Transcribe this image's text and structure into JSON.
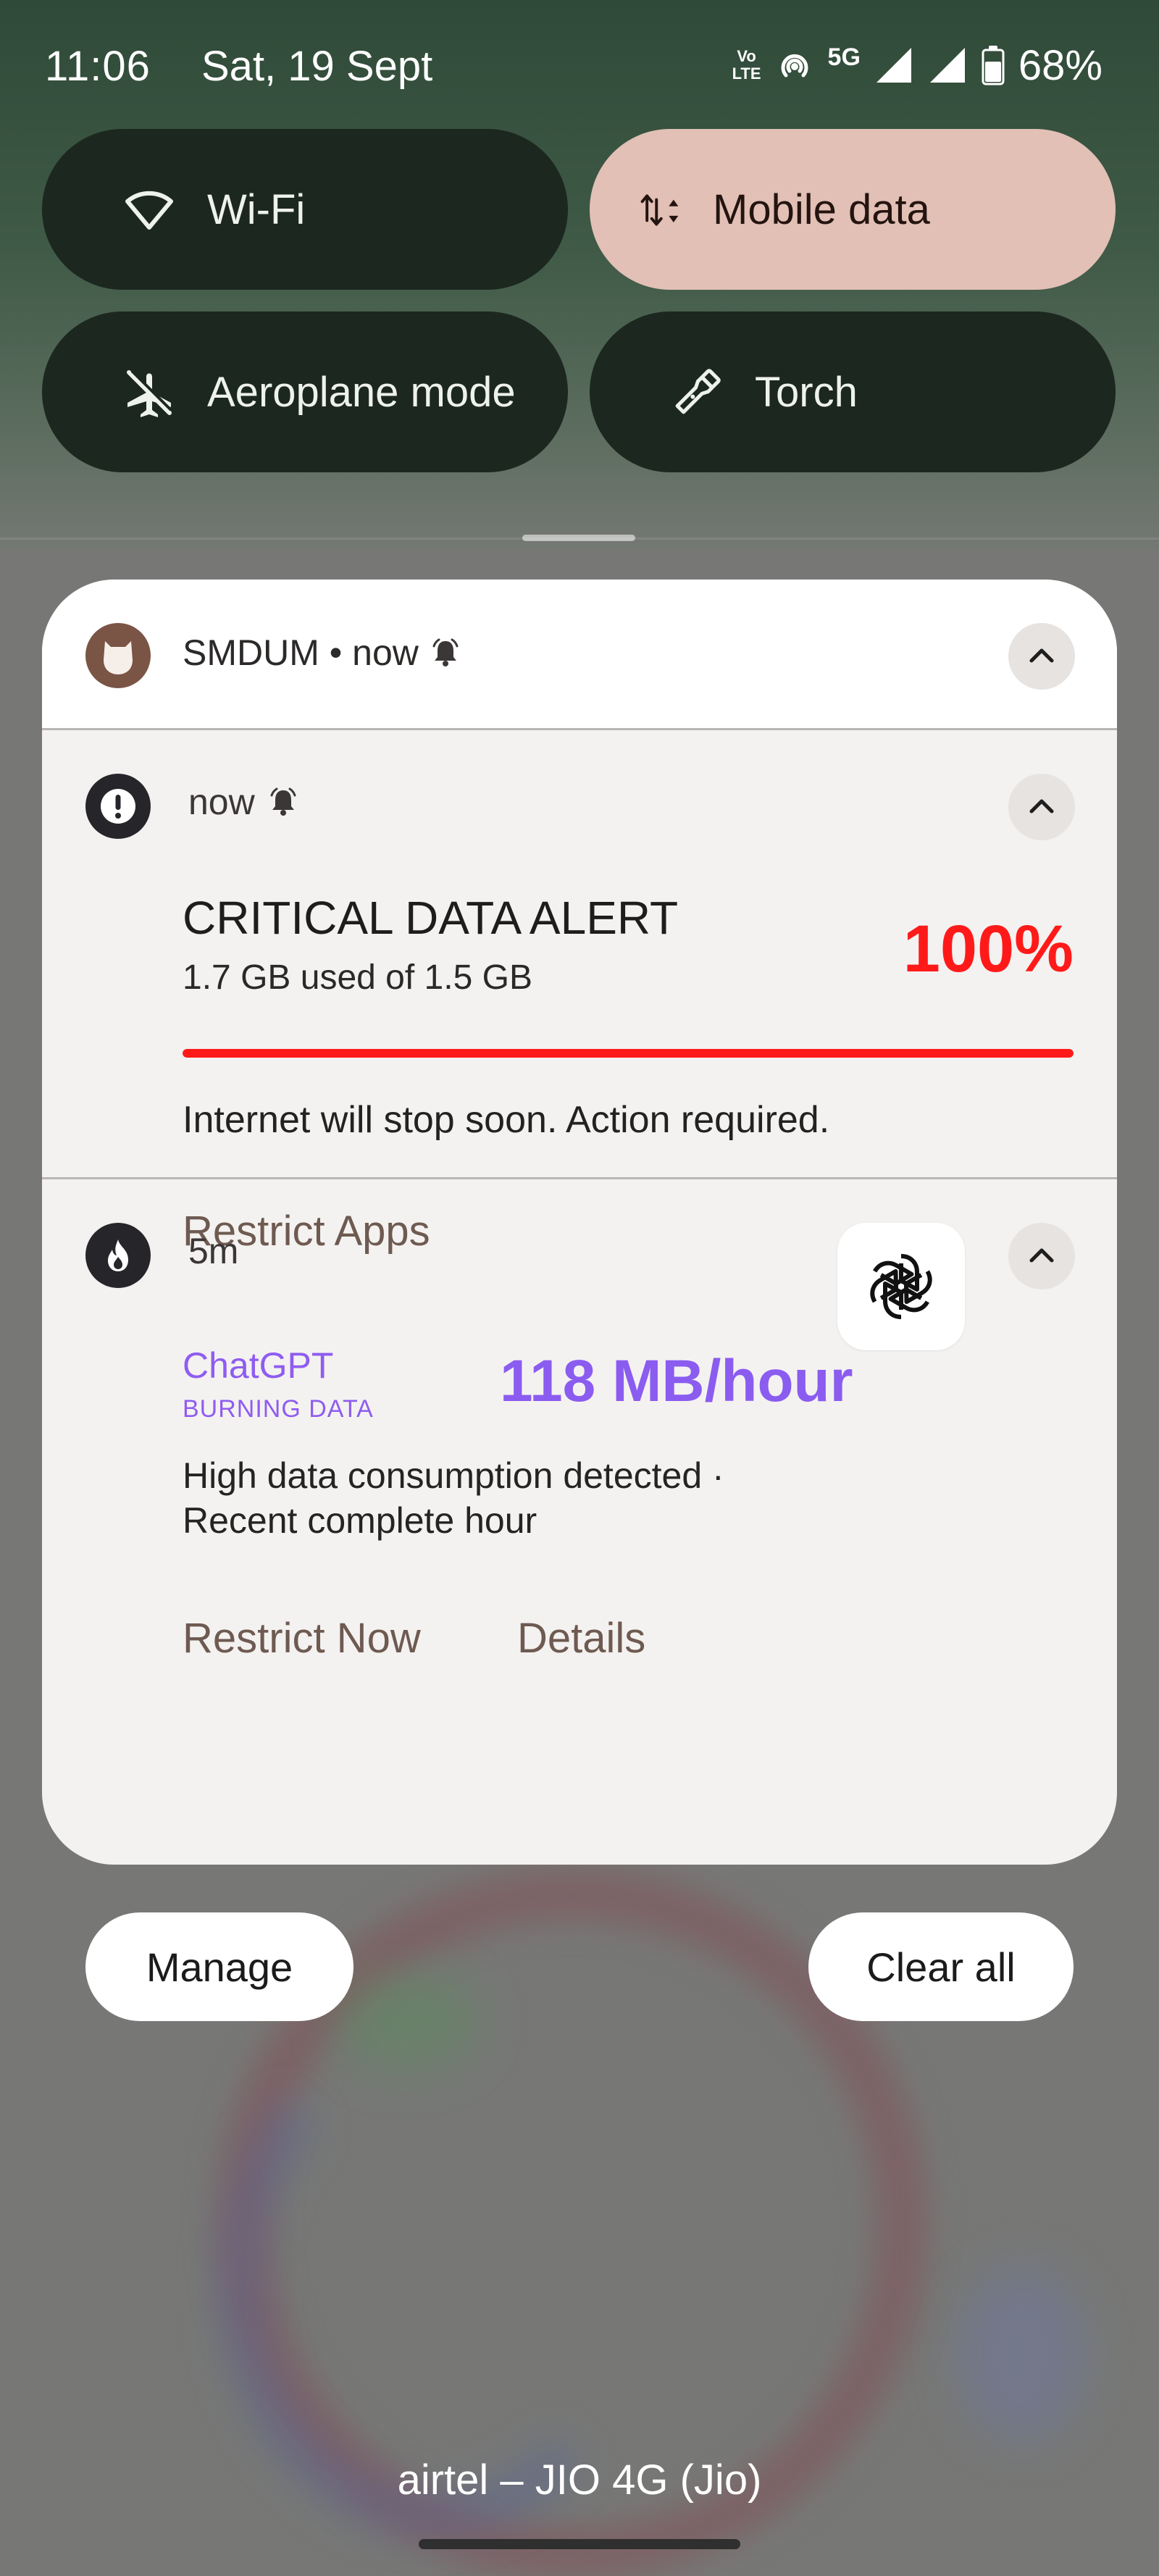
{
  "status_bar": {
    "time": "11:06",
    "date": "Sat, 19 Sept",
    "volte_top": "Vo",
    "volte_bottom": "LTE",
    "network_type": "5G",
    "battery_percent": "68%",
    "battery_level": 0.68,
    "icons": [
      "volte-icon",
      "hotspot-icon",
      "signal-icon",
      "signal-icon",
      "battery-icon"
    ]
  },
  "quick_tiles": [
    {
      "label": "Wi-Fi",
      "icon": "wifi-icon",
      "active": false
    },
    {
      "label": "Mobile data",
      "icon": "mobile-data-icon",
      "active": true
    },
    {
      "label": "Aeroplane mode",
      "icon": "airplane-icon",
      "active": false
    },
    {
      "label": "Torch",
      "icon": "torch-icon",
      "active": false
    }
  ],
  "notification_group": {
    "app_name": "SMDUM",
    "time": "now",
    "header_text": "SMDUM • now",
    "alert_icon": "bell-icon"
  },
  "notifications": [
    {
      "icon": "exclamation-icon",
      "time": "now",
      "title": "CRITICAL DATA ALERT",
      "usage": "1.7 GB used of 1.5 GB",
      "percent": "100%",
      "progress": 1.0,
      "message": "Internet will stop soon. Action required.",
      "actions": [
        "Restrict Apps"
      ]
    },
    {
      "icon": "flame-icon",
      "time": "5m",
      "app": "ChatGPT",
      "tag": "BURNING DATA",
      "rate": "118 MB/hour",
      "description_line1": "High data consumption detected ·",
      "description_line2": "Recent complete hour",
      "large_icon": "openai-logo-icon",
      "actions": [
        "Restrict Now",
        "Details"
      ]
    }
  ],
  "footer": {
    "manage_label": "Manage",
    "clear_all_label": "Clear all",
    "carrier_text": "airtel – JIO 4G (Jio)"
  },
  "colors": {
    "critical": "#ff1a1a",
    "accent_purple": "#8b5cf0",
    "active_tile": "#e2c0b6",
    "tile": "#1c271f",
    "action_text": "#6e5a51"
  }
}
